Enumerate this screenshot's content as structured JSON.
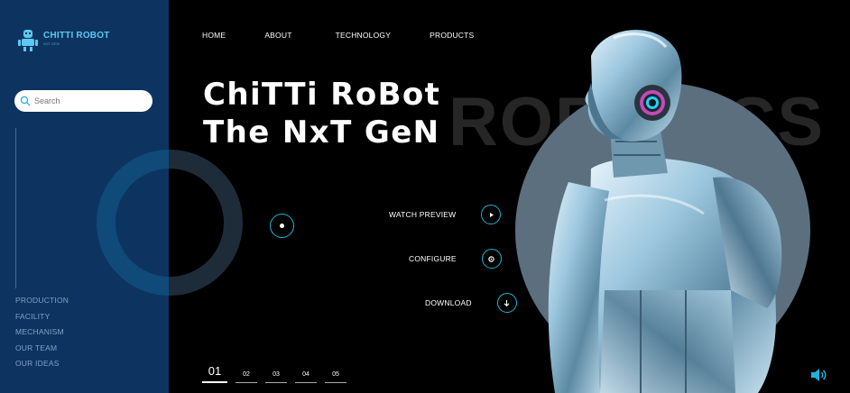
{
  "brand": {
    "name": "CHITTI ROBOT",
    "tagline": "NXT GEN"
  },
  "search": {
    "placeholder": "Search"
  },
  "sidebar": {
    "items": [
      {
        "label": "PRODUCTION"
      },
      {
        "label": "FACILITY"
      },
      {
        "label": "MECHANISM"
      },
      {
        "label": "OUR TEAM"
      },
      {
        "label": "OUR IDEAS"
      }
    ]
  },
  "nav": {
    "items": [
      {
        "label": "HOME"
      },
      {
        "label": "ABOUT"
      },
      {
        "label": "TECHNOLOGY"
      },
      {
        "label": "PRODUCTS"
      }
    ]
  },
  "hero": {
    "line1": "ChiTTi RoBot",
    "line2": "The NxT GeN",
    "background_word": "ROBOTICS"
  },
  "actions": [
    {
      "label": "WATCH PREVIEW",
      "icon": "play-icon"
    },
    {
      "label": "CONFIGURE",
      "icon": "gear-icon"
    },
    {
      "label": "DOWNLOAD",
      "icon": "download-arrow-icon"
    }
  ],
  "pager": {
    "pages": [
      "01",
      "02",
      "03",
      "04",
      "05"
    ],
    "active": "01"
  },
  "colors": {
    "sidebar_bg": "#0d3460",
    "accent": "#1fb3d9",
    "circle": "#5c6f7e",
    "background": "#000000"
  }
}
